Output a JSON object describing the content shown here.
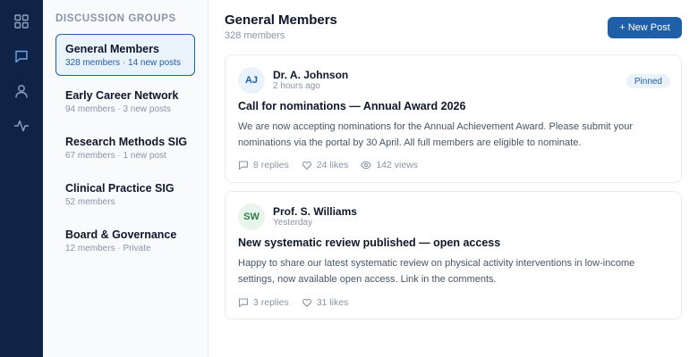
{
  "rail": {
    "icons": [
      "grid-icon",
      "chat-icon",
      "user-icon",
      "activity-icon"
    ],
    "active_color": "#6fa8e6",
    "icon_color": "#8fa3c4"
  },
  "groups": {
    "title": "DISCUSSION GROUPS",
    "items": [
      {
        "name": "General Members",
        "meta": "328 members · 14 new posts",
        "active": true
      },
      {
        "name": "Early Career Network",
        "meta": "94 members · 3 new posts"
      },
      {
        "name": "Research Methods SIG",
        "meta": "67 members · 1 new post"
      },
      {
        "name": "Clinical Practice SIG",
        "meta": "52 members"
      },
      {
        "name": "Board & Governance",
        "meta": "12 members · Private"
      }
    ]
  },
  "feed": {
    "title": "General Members",
    "subtitle": "328 members",
    "new_post_label": "+ New Post",
    "accent": "#1f5fa8",
    "posts": [
      {
        "initials": "AJ",
        "avatar_bg": "#eaf2fc",
        "avatar_fg": "#1f5fa8",
        "author": "Dr. A. Johnson",
        "time": "2 hours ago",
        "badge": "Pinned",
        "title": "Call for nominations — Annual Award 2026",
        "body": "We are now accepting nominations for the Annual Achievement Award. Please submit your nominations via the portal by 30 April. All full members are eligible to nominate.",
        "replies": "8 replies",
        "likes": "24 likes",
        "views": "142 views"
      },
      {
        "initials": "SW",
        "avatar_bg": "#e8f5ec",
        "avatar_fg": "#2e7d4a",
        "author": "Prof. S. Williams",
        "time": "Yesterday",
        "title": "New systematic review published — open access",
        "body": "Happy to share our latest systematic review on physical activity interventions in low-income settings, now available open access. Link in the comments.",
        "replies": "3 replies",
        "likes": "31 likes"
      }
    ]
  }
}
